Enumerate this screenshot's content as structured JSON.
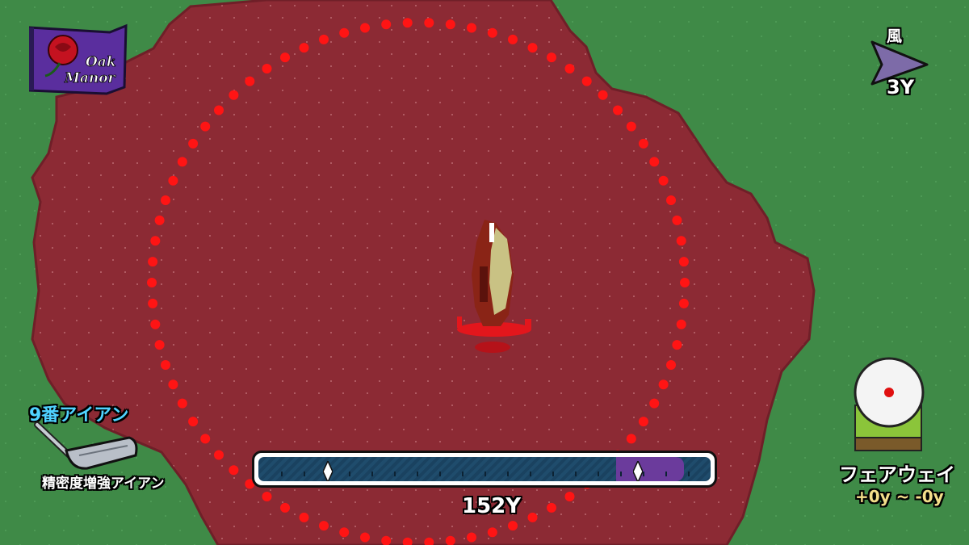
{
  "course": {
    "name_line1": "Oak",
    "name_line2": "Manor"
  },
  "wind": {
    "label": "風",
    "value": "3Y",
    "direction": "east"
  },
  "club": {
    "name": "9番アイアン",
    "description": "精密度増強アイアン"
  },
  "shot": {
    "distance": "152Y",
    "power_fraction": 0.84
  },
  "lie": {
    "label": "フェアウェイ",
    "range": "+0y ~ -0y"
  },
  "colors": {
    "grass": "#3f8a47",
    "bloodground": "#8c2a34",
    "target_ring": "#ff1414",
    "accent_club": "#4fd2ff",
    "accent_range": "#f3de8a",
    "bar_fill": "#1f4c6c",
    "bar_zone": "#6b3b9c"
  }
}
